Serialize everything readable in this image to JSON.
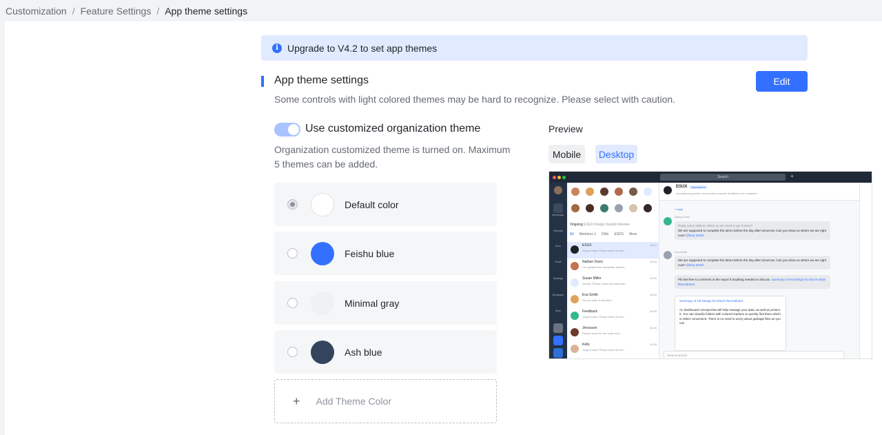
{
  "breadcrumb": {
    "items": [
      "Customization",
      "Feature Settings"
    ],
    "current": "App theme settings",
    "separator": "/"
  },
  "notice": {
    "icon": "info-icon",
    "text": "Upgrade to V4.2 to set app themes"
  },
  "section": {
    "title": "App theme settings",
    "description": "Some controls with light colored themes may be hard to recognize. Please select with caution.",
    "edit_label": "Edit"
  },
  "org_theme": {
    "enabled": true,
    "label": "Use customized organization theme",
    "description": "Organization customized theme is turned on. Maximum 5 themes can be added."
  },
  "themes": [
    {
      "name": "Default color",
      "color": "#ffffff",
      "selected": true
    },
    {
      "name": "Feishu blue",
      "color": "#3370ff",
      "selected": false
    },
    {
      "name": "Minimal gray",
      "color": "#f2f3f5",
      "selected": false
    },
    {
      "name": "Ash blue",
      "color": "#34445e",
      "selected": false
    }
  ],
  "add_theme": {
    "icon": "plus-icon",
    "label": "Add Theme Color"
  },
  "preview": {
    "label": "Preview",
    "tabs": [
      "Mobile",
      "Desktop"
    ],
    "active_tab": "Desktop",
    "mock": {
      "search": "Search",
      "nav": [
        "Messenger",
        "Calendar",
        "Docs",
        "Email",
        "Meetings",
        "Workplace",
        "More"
      ],
      "ongoing": "Ongoing",
      "ongoing_text": "ESUX Design System Review",
      "list_tabs": [
        "All",
        "Mentions 1",
        "DMs",
        "ESDS",
        "More"
      ],
      "chats": [
        {
          "name": "ESUX",
          "badge": "Department",
          "sub": "Jorge Evans: Please send me the...",
          "time": "16:03"
        },
        {
          "name": "Nathan Davis",
          "sub": "I've updated the newsletter draft in...",
          "time": "15:04"
        },
        {
          "name": "Susan Miller",
          "sub": "Jordan: Please check the schedule...",
          "time": "15:00"
        },
        {
          "name": "Eva Smith",
          "sub": "Do you have 5 minutes?",
          "time": "15:00"
        },
        {
          "name": "Feedback",
          "badge": "Public",
          "sub": "Jorge Evans: Please send me the...",
          "time": "15:00"
        },
        {
          "name": "Jhnosson",
          "sub": "Please send me the code now...",
          "time": "15:45"
        },
        {
          "name": "Kelly",
          "sub": "Jorge Evans: Please send me the...",
          "time": "15:00"
        }
      ],
      "chat_title": "ESUX",
      "chat_badge": "Department",
      "chat_sub": "Including bug report, new feature request, feedback from customer",
      "reply": "1 reply",
      "sender1": "Nancy Chen",
      "quote1": "Reply Aaron Wilson: When do we need to get it done?",
      "msg1": "We are supposed to complete the demo before the day after tomorrow. Can you show us where we are right now?",
      "mention": "@Eva Smith",
      "sender2": "Eva Smith",
      "msg2": "We are supposed to complete the demo before the day after tomorrow. Can you show us where we are right now?",
      "msg3": "Pls feel free to comment in the report if anything needed to discuss.",
      "msg3_link": "Summary of H5 Design for ESUX-2019 Recruitment",
      "card_title": "Summary of H5 Design for ESUX Recruitment",
      "card_body": "An dashboard concept that will help manage your data, as well as protect it. You can classify folders with colored markers to quickly find them which is rather convenient. There is no need to worry about garbage files as you can",
      "input_placeholder": "Send to ESUX"
    }
  }
}
